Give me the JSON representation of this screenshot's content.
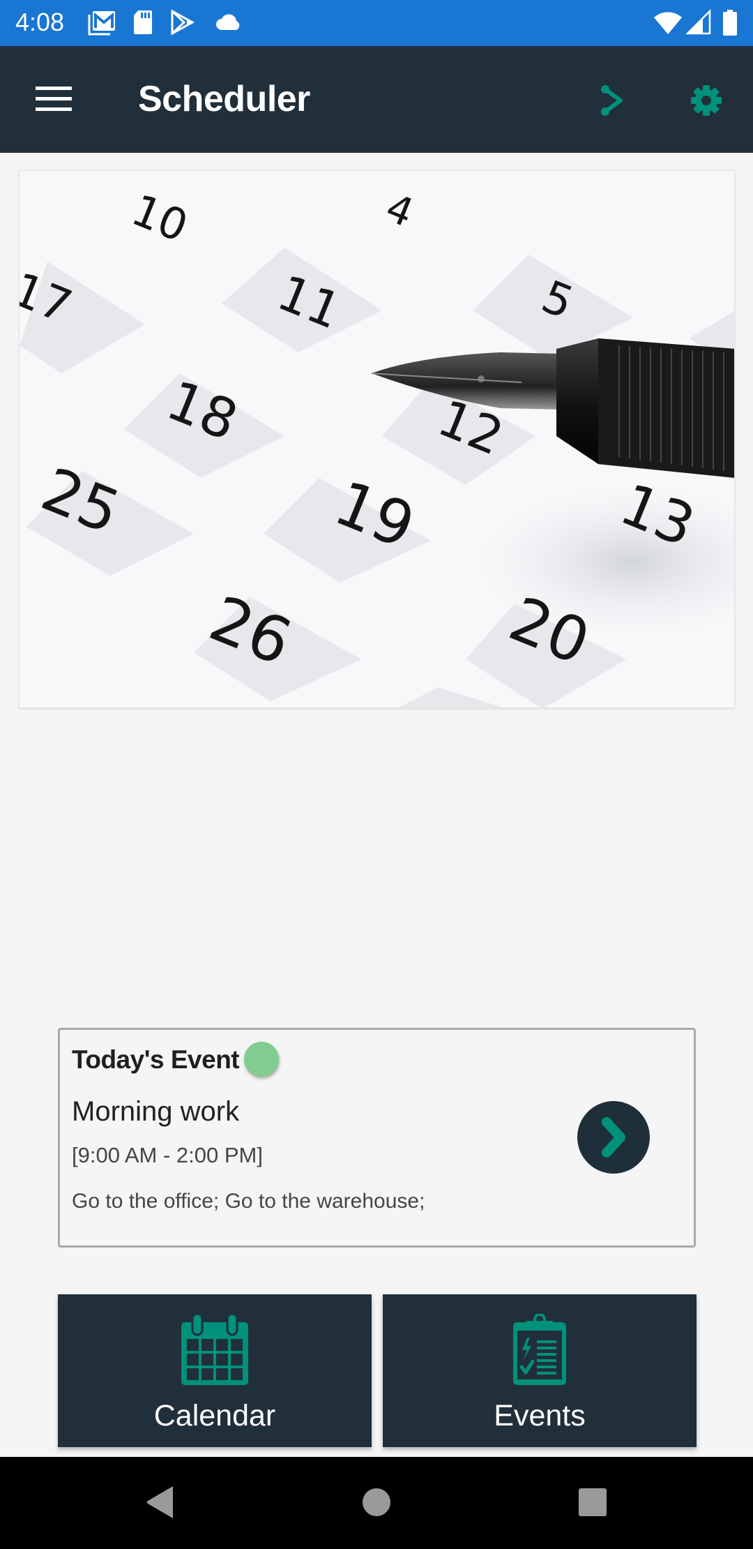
{
  "status_bar": {
    "time": "4:08",
    "left_icons": [
      "gmail-icon",
      "sd-card-icon",
      "play-store-icon",
      "cloud-icon"
    ],
    "right_icons": [
      "wifi-icon",
      "cellular-signal-icon",
      "battery-icon"
    ],
    "color": "#1976d2"
  },
  "app_bar": {
    "title": "Scheduler",
    "menu_icon": "hamburger-menu-icon",
    "actions": [
      {
        "name": "share",
        "icon": "share-icon"
      },
      {
        "name": "settings",
        "icon": "gear-icon"
      }
    ],
    "background": "#212f3b",
    "accent": "#00917a"
  },
  "hero_image": {
    "description": "Calendar page with fountain pen",
    "visible_dates": [
      "10",
      "4",
      "17",
      "11",
      "5",
      "18",
      "12",
      "25",
      "19",
      "13",
      "26",
      "20"
    ]
  },
  "todays_event": {
    "heading": "Today's Event",
    "status_color": "#81cd8f",
    "title": "Morning work",
    "time_range": "[9:00 AM - 2:00 PM]",
    "description": "Go to the office; Go to the warehouse;",
    "open_button_icon": "chevron-right-icon"
  },
  "tiles": [
    {
      "label": "Calendar",
      "icon": "calendar-icon"
    },
    {
      "label": "Events",
      "icon": "clipboard-checklist-icon"
    }
  ],
  "nav_bar": {
    "buttons": [
      "back",
      "home",
      "recents"
    ]
  }
}
